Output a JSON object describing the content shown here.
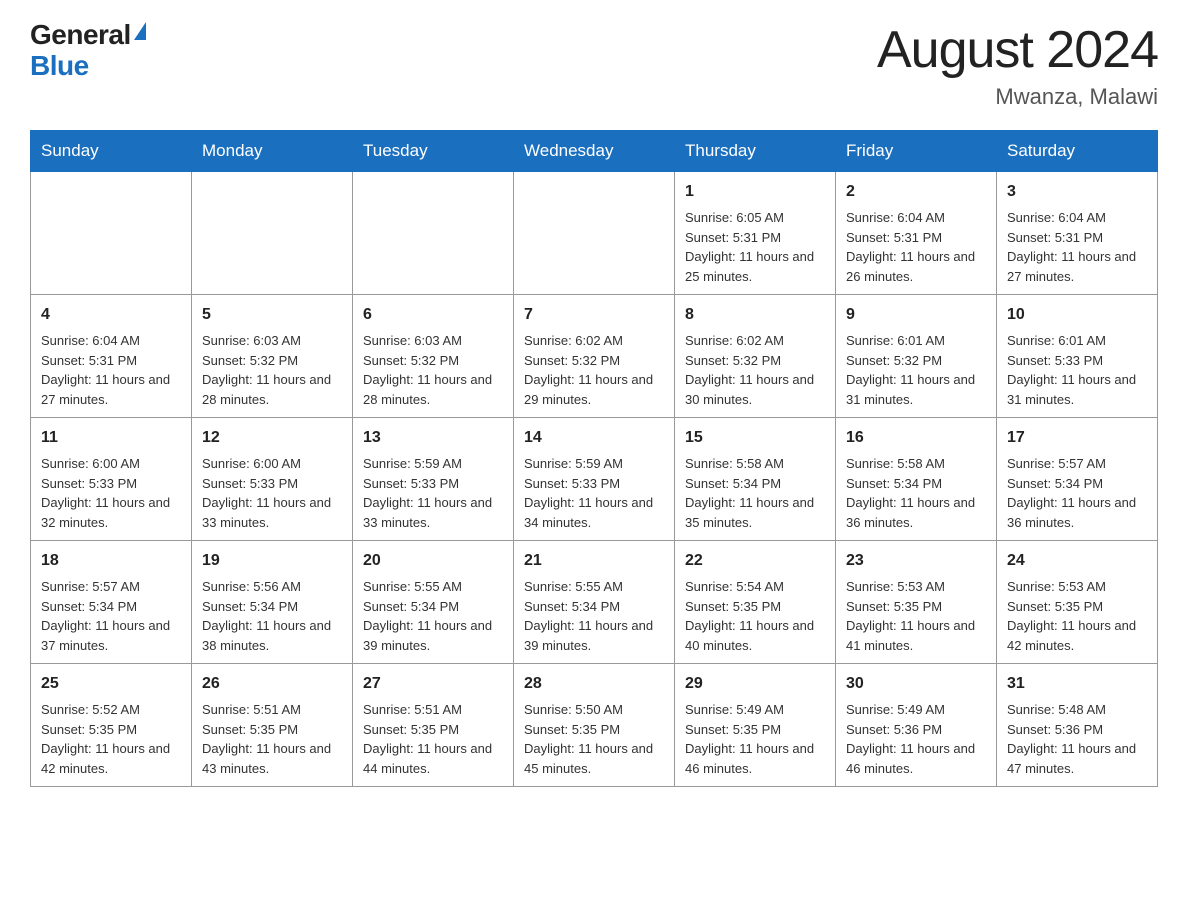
{
  "header": {
    "logo_general": "General",
    "logo_blue": "Blue",
    "month_title": "August 2024",
    "location": "Mwanza, Malawi"
  },
  "days_of_week": [
    "Sunday",
    "Monday",
    "Tuesday",
    "Wednesday",
    "Thursday",
    "Friday",
    "Saturday"
  ],
  "weeks": [
    [
      {
        "num": "",
        "info": ""
      },
      {
        "num": "",
        "info": ""
      },
      {
        "num": "",
        "info": ""
      },
      {
        "num": "",
        "info": ""
      },
      {
        "num": "1",
        "info": "Sunrise: 6:05 AM\nSunset: 5:31 PM\nDaylight: 11 hours and 25 minutes."
      },
      {
        "num": "2",
        "info": "Sunrise: 6:04 AM\nSunset: 5:31 PM\nDaylight: 11 hours and 26 minutes."
      },
      {
        "num": "3",
        "info": "Sunrise: 6:04 AM\nSunset: 5:31 PM\nDaylight: 11 hours and 27 minutes."
      }
    ],
    [
      {
        "num": "4",
        "info": "Sunrise: 6:04 AM\nSunset: 5:31 PM\nDaylight: 11 hours and 27 minutes."
      },
      {
        "num": "5",
        "info": "Sunrise: 6:03 AM\nSunset: 5:32 PM\nDaylight: 11 hours and 28 minutes."
      },
      {
        "num": "6",
        "info": "Sunrise: 6:03 AM\nSunset: 5:32 PM\nDaylight: 11 hours and 28 minutes."
      },
      {
        "num": "7",
        "info": "Sunrise: 6:02 AM\nSunset: 5:32 PM\nDaylight: 11 hours and 29 minutes."
      },
      {
        "num": "8",
        "info": "Sunrise: 6:02 AM\nSunset: 5:32 PM\nDaylight: 11 hours and 30 minutes."
      },
      {
        "num": "9",
        "info": "Sunrise: 6:01 AM\nSunset: 5:32 PM\nDaylight: 11 hours and 31 minutes."
      },
      {
        "num": "10",
        "info": "Sunrise: 6:01 AM\nSunset: 5:33 PM\nDaylight: 11 hours and 31 minutes."
      }
    ],
    [
      {
        "num": "11",
        "info": "Sunrise: 6:00 AM\nSunset: 5:33 PM\nDaylight: 11 hours and 32 minutes."
      },
      {
        "num": "12",
        "info": "Sunrise: 6:00 AM\nSunset: 5:33 PM\nDaylight: 11 hours and 33 minutes."
      },
      {
        "num": "13",
        "info": "Sunrise: 5:59 AM\nSunset: 5:33 PM\nDaylight: 11 hours and 33 minutes."
      },
      {
        "num": "14",
        "info": "Sunrise: 5:59 AM\nSunset: 5:33 PM\nDaylight: 11 hours and 34 minutes."
      },
      {
        "num": "15",
        "info": "Sunrise: 5:58 AM\nSunset: 5:34 PM\nDaylight: 11 hours and 35 minutes."
      },
      {
        "num": "16",
        "info": "Sunrise: 5:58 AM\nSunset: 5:34 PM\nDaylight: 11 hours and 36 minutes."
      },
      {
        "num": "17",
        "info": "Sunrise: 5:57 AM\nSunset: 5:34 PM\nDaylight: 11 hours and 36 minutes."
      }
    ],
    [
      {
        "num": "18",
        "info": "Sunrise: 5:57 AM\nSunset: 5:34 PM\nDaylight: 11 hours and 37 minutes."
      },
      {
        "num": "19",
        "info": "Sunrise: 5:56 AM\nSunset: 5:34 PM\nDaylight: 11 hours and 38 minutes."
      },
      {
        "num": "20",
        "info": "Sunrise: 5:55 AM\nSunset: 5:34 PM\nDaylight: 11 hours and 39 minutes."
      },
      {
        "num": "21",
        "info": "Sunrise: 5:55 AM\nSunset: 5:34 PM\nDaylight: 11 hours and 39 minutes."
      },
      {
        "num": "22",
        "info": "Sunrise: 5:54 AM\nSunset: 5:35 PM\nDaylight: 11 hours and 40 minutes."
      },
      {
        "num": "23",
        "info": "Sunrise: 5:53 AM\nSunset: 5:35 PM\nDaylight: 11 hours and 41 minutes."
      },
      {
        "num": "24",
        "info": "Sunrise: 5:53 AM\nSunset: 5:35 PM\nDaylight: 11 hours and 42 minutes."
      }
    ],
    [
      {
        "num": "25",
        "info": "Sunrise: 5:52 AM\nSunset: 5:35 PM\nDaylight: 11 hours and 42 minutes."
      },
      {
        "num": "26",
        "info": "Sunrise: 5:51 AM\nSunset: 5:35 PM\nDaylight: 11 hours and 43 minutes."
      },
      {
        "num": "27",
        "info": "Sunrise: 5:51 AM\nSunset: 5:35 PM\nDaylight: 11 hours and 44 minutes."
      },
      {
        "num": "28",
        "info": "Sunrise: 5:50 AM\nSunset: 5:35 PM\nDaylight: 11 hours and 45 minutes."
      },
      {
        "num": "29",
        "info": "Sunrise: 5:49 AM\nSunset: 5:35 PM\nDaylight: 11 hours and 46 minutes."
      },
      {
        "num": "30",
        "info": "Sunrise: 5:49 AM\nSunset: 5:36 PM\nDaylight: 11 hours and 46 minutes."
      },
      {
        "num": "31",
        "info": "Sunrise: 5:48 AM\nSunset: 5:36 PM\nDaylight: 11 hours and 47 minutes."
      }
    ]
  ]
}
